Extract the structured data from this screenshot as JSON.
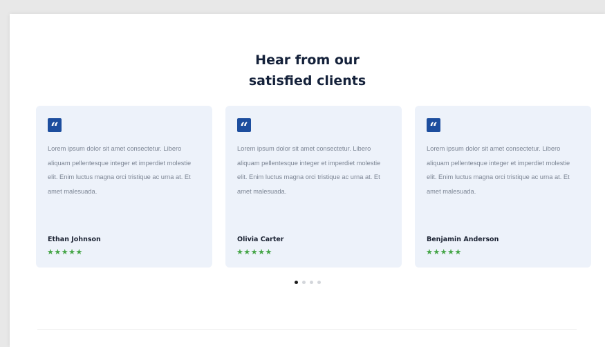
{
  "section": {
    "title_line1": "Hear from our",
    "title_line2": "satisfied clients"
  },
  "testimonials": [
    {
      "quote_icon": "quote-icon",
      "text": "Lorem ipsum dolor sit amet consectetur. Libero aliquam pellentesque integer et imperdiet molestie elit. Enim luctus magna orci tristique ac urna at. Et amet malesuada.",
      "name": "Ethan Johnson",
      "rating": 5,
      "stars": "★★★★★"
    },
    {
      "quote_icon": "quote-icon",
      "text": "Lorem ipsum dolor sit amet consectetur. Libero aliquam pellentesque integer et imperdiet molestie elit. Enim luctus magna orci tristique ac urna at. Et amet malesuada.",
      "name": "Olivia Carter",
      "rating": 5,
      "stars": "★★★★★"
    },
    {
      "quote_icon": "quote-icon",
      "text": "Lorem ipsum dolor sit amet consectetur. Libero aliquam pellentesque integer et imperdiet molestie elit. Enim luctus magna orci tristique ac urna at. Et amet malesuada.",
      "name": "Benjamin Anderson",
      "rating": 5,
      "stars": "★★★★★"
    }
  ],
  "pagination": {
    "count": 4,
    "active": 0
  },
  "colors": {
    "title": "#14213a",
    "card_bg": "#edf2fa",
    "quote_icon_bg": "#1d4e9e",
    "stars": "#45a547",
    "dot_active": "#1b1b1b",
    "dot_inactive": "#d3d6db"
  }
}
